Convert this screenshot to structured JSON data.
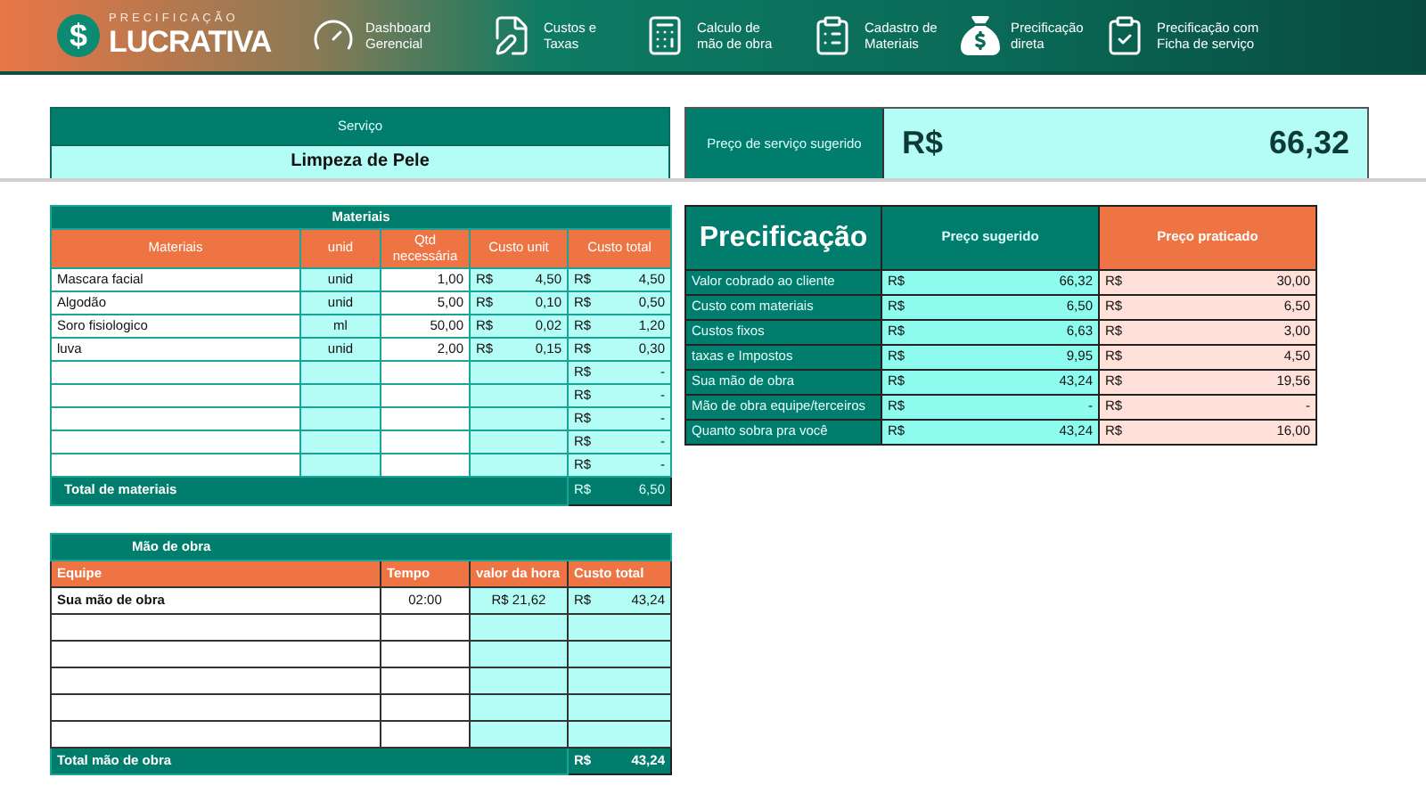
{
  "header": {
    "logo": {
      "symbol": "$",
      "top": "PRECIFICAÇÃO",
      "main": "LUCRATIVA"
    },
    "nav": [
      {
        "lines": [
          "Dashboard",
          "Gerencial"
        ]
      },
      {
        "lines": [
          "Custos e",
          "Taxas"
        ]
      },
      {
        "lines": [
          "Calculo de",
          "mão de obra"
        ]
      },
      {
        "lines": [
          "Cadastro de",
          "Materiais"
        ]
      },
      {
        "lines": [
          "Precificação",
          "direta"
        ]
      },
      {
        "lines": [
          "Precificação com",
          "Ficha de serviço"
        ]
      }
    ]
  },
  "service": {
    "label": "Serviço",
    "value": "Limpeza de Pele"
  },
  "suggested_price": {
    "label": "Preço de serviço sugerido",
    "currency": "R$",
    "value": "66,32"
  },
  "materials": {
    "title": "Materiais",
    "columns": [
      "Materiais",
      "unid",
      "Qtd necessária",
      "Custo unit",
      "Custo total"
    ],
    "rows": [
      {
        "name": "Mascara facial",
        "unit": "unid",
        "qty": "1,00",
        "unit_cost": {
          "currency": "R$",
          "value": "4,50"
        },
        "total": {
          "currency": "R$",
          "value": "4,50"
        }
      },
      {
        "name": "Algodão",
        "unit": "unid",
        "qty": "5,00",
        "unit_cost": {
          "currency": "R$",
          "value": "0,10"
        },
        "total": {
          "currency": "R$",
          "value": "0,50"
        }
      },
      {
        "name": "Soro fisiologico",
        "unit": "ml",
        "qty": "50,00",
        "unit_cost": {
          "currency": "R$",
          "value": "0,02"
        },
        "total": {
          "currency": "R$",
          "value": "1,20"
        }
      },
      {
        "name": "luva",
        "unit": "unid",
        "qty": "2,00",
        "unit_cost": {
          "currency": "R$",
          "value": "0,15"
        },
        "total": {
          "currency": "R$",
          "value": "0,30"
        }
      },
      {
        "total": {
          "currency": "R$",
          "value": "-"
        }
      },
      {
        "total": {
          "currency": "R$",
          "value": "-"
        }
      },
      {
        "total": {
          "currency": "R$",
          "value": "-"
        }
      },
      {
        "total": {
          "currency": "R$",
          "value": "-"
        }
      },
      {
        "total": {
          "currency": "R$",
          "value": "-"
        }
      }
    ],
    "total": {
      "label": "Total de materiais",
      "currency": "R$",
      "value": "6,50"
    }
  },
  "labor": {
    "title": "Mão de obra",
    "columns": [
      "Equipe",
      "Tempo",
      "valor da hora",
      "Custo total"
    ],
    "rows": [
      {
        "name": "Sua mão de obra",
        "time": "02:00",
        "hourly": "R$ 21,62",
        "total": {
          "currency": "R$",
          "value": "43,24"
        }
      },
      {},
      {},
      {},
      {},
      {}
    ],
    "total": {
      "label": "Total mão de obra",
      "currency": "R$",
      "value": "43,24"
    }
  },
  "pricing": {
    "title": "Precificação",
    "columns": [
      "Preço sugerido",
      "Preço praticado"
    ],
    "rows": [
      {
        "label": "Valor cobrado ao cliente",
        "suggested": {
          "currency": "R$",
          "value": "66,32"
        },
        "practiced": {
          "currency": "R$",
          "value": "30,00"
        }
      },
      {
        "label": "Custo com materiais",
        "suggested": {
          "currency": "R$",
          "value": "6,50"
        },
        "practiced": {
          "currency": "R$",
          "value": "6,50"
        }
      },
      {
        "label": "Custos fixos",
        "suggested": {
          "currency": "R$",
          "value": "6,63"
        },
        "practiced": {
          "currency": "R$",
          "value": "3,00"
        }
      },
      {
        "label": "taxas e Impostos",
        "suggested": {
          "currency": "R$",
          "value": "9,95"
        },
        "practiced": {
          "currency": "R$",
          "value": "4,50"
        }
      },
      {
        "label": "Sua mão de obra",
        "suggested": {
          "currency": "R$",
          "value": "43,24"
        },
        "practiced": {
          "currency": "R$",
          "value": "19,56"
        }
      },
      {
        "label": "Mão de obra equipe/terceiros",
        "suggested": {
          "currency": "R$",
          "value": "-"
        },
        "practiced": {
          "currency": "R$",
          "value": "-"
        }
      },
      {
        "label": "Quanto sobra pra você",
        "suggested": {
          "currency": "R$",
          "value": "43,24"
        },
        "practiced": {
          "currency": "R$",
          "value": "16,00"
        }
      }
    ]
  }
}
